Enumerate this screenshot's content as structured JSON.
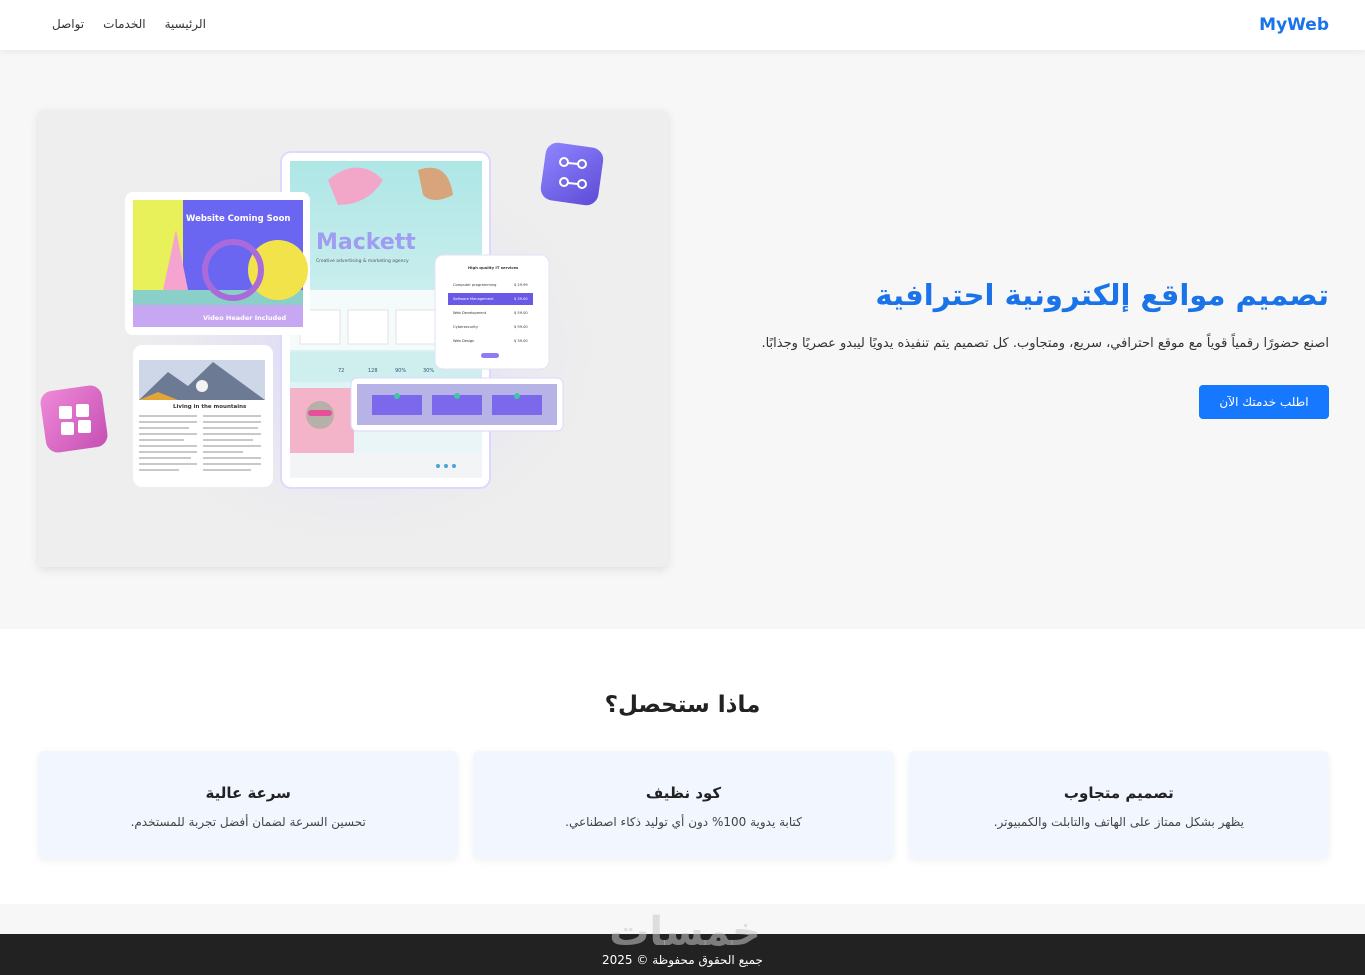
{
  "header": {
    "logo": "MyWeb",
    "nav": [
      {
        "label": "الرئيسية"
      },
      {
        "label": "الخدمات"
      },
      {
        "label": "تواصل"
      }
    ]
  },
  "hero": {
    "title": "تصميم مواقع إلكترونية احترافية",
    "subtitle": "اصنع حضورًا رقمياً قوياً مع موقع احترافي، سريع، ومتجاوب. كل تصميم يتم تنفيذه يدويًا ليبدو عصريًا وجذابًا.",
    "cta_label": "اطلب خدمتك الآن",
    "mockup": {
      "coming_soon": "Website Coming Soon",
      "video_header": "Video Header Included",
      "brand": "Mackett",
      "tagline": "Creative advertising & marketing agency",
      "blog_title": "Living in the mountains",
      "list_title": "High quality IT services",
      "list_items": [
        {
          "label": "Computer programming",
          "price": "$ 29.99"
        },
        {
          "label": "Software Management",
          "price": "$ 39.00"
        },
        {
          "label": "Web Development",
          "price": "$ 59.00"
        },
        {
          "label": "Cybersecurity",
          "price": "$ 99.00"
        },
        {
          "label": "Web Design",
          "price": "$ 39.00"
        }
      ],
      "stats": [
        "72",
        "128",
        "90%",
        "30%"
      ]
    }
  },
  "features": {
    "title": "ماذا ستحصل؟",
    "cards": [
      {
        "title": "تصميم متجاوب",
        "text": "يظهر بشكل ممتاز على الهاتف والتابلت والكمبيوتر."
      },
      {
        "title": "كود نظيف",
        "text": "كتابة يدوية 100% دون أي توليد ذكاء اصطناعي."
      },
      {
        "title": "سرعة عالية",
        "text": "تحسين السرعة لضمان أفضل تجربة للمستخدم."
      }
    ]
  },
  "footer": {
    "text": "جميع الحقوق محفوظة © 2025",
    "watermark": "خمسات"
  },
  "colors": {
    "accent": "#1a73e8",
    "button": "#1677ff",
    "card_bg": "#f1f6ff",
    "footer_bg": "#222222"
  }
}
